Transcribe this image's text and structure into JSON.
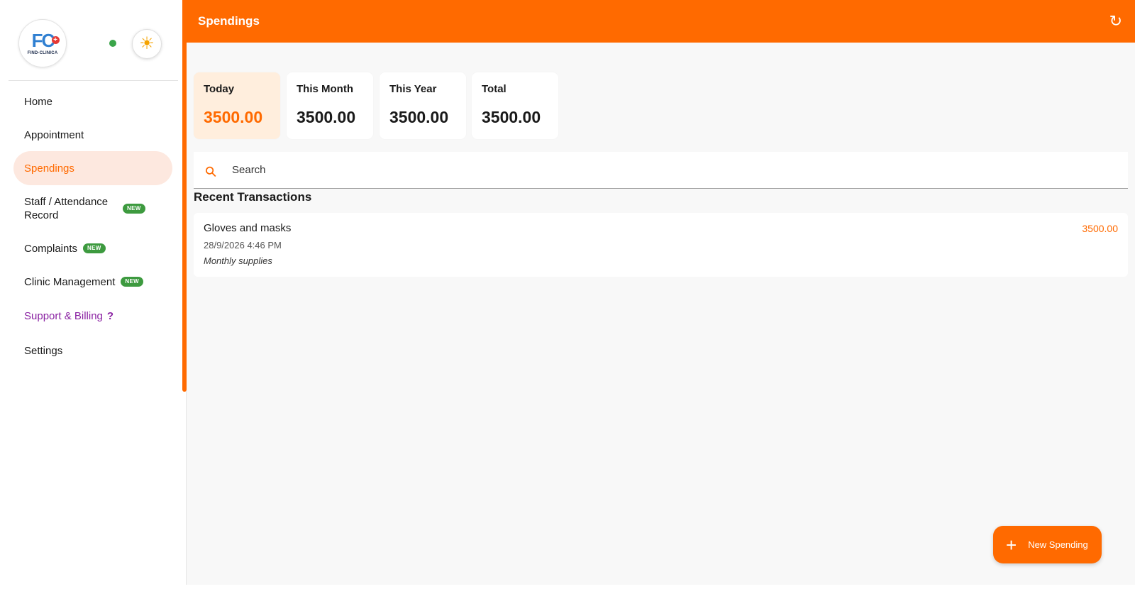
{
  "sidebar": {
    "logo_text": "FIND-CLINICA",
    "logo_mark": "FC",
    "online_color": "#3aa54a",
    "theme_icon": "sun-icon",
    "nav": [
      {
        "label": "Home"
      },
      {
        "label": "Appointment"
      },
      {
        "label": "Spendings",
        "active": true
      },
      {
        "label": "Staff / Attendance Record",
        "badge": "NEW"
      },
      {
        "label": "Complaints",
        "badge": "NEW"
      },
      {
        "label": "Clinic Management",
        "badge": "NEW"
      },
      {
        "label": "Support & Billing",
        "icon": "help-icon"
      },
      {
        "label": "Settings"
      }
    ]
  },
  "header": {
    "title": "Spendings",
    "refresh_icon": "refresh-icon"
  },
  "stats": [
    {
      "label": "Today",
      "value": "3500.00",
      "highlight": true
    },
    {
      "label": "This Month",
      "value": "3500.00"
    },
    {
      "label": "This Year",
      "value": "3500.00"
    },
    {
      "label": "Total",
      "value": "3500.00"
    }
  ],
  "search": {
    "placeholder": "Search",
    "value": ""
  },
  "transactions": {
    "title": "Recent Transactions",
    "items": [
      {
        "title": "Gloves and masks",
        "date": "28/9/2026 4:46 PM",
        "note": "Monthly supplies",
        "amount": "3500.00"
      }
    ]
  },
  "fab": {
    "label": "New Spending",
    "icon": "plus-icon"
  },
  "colors": {
    "accent": "#ff6a00",
    "active_bg": "#fde8df",
    "badge": "#3d9a3f",
    "support": "#8b23a3"
  }
}
